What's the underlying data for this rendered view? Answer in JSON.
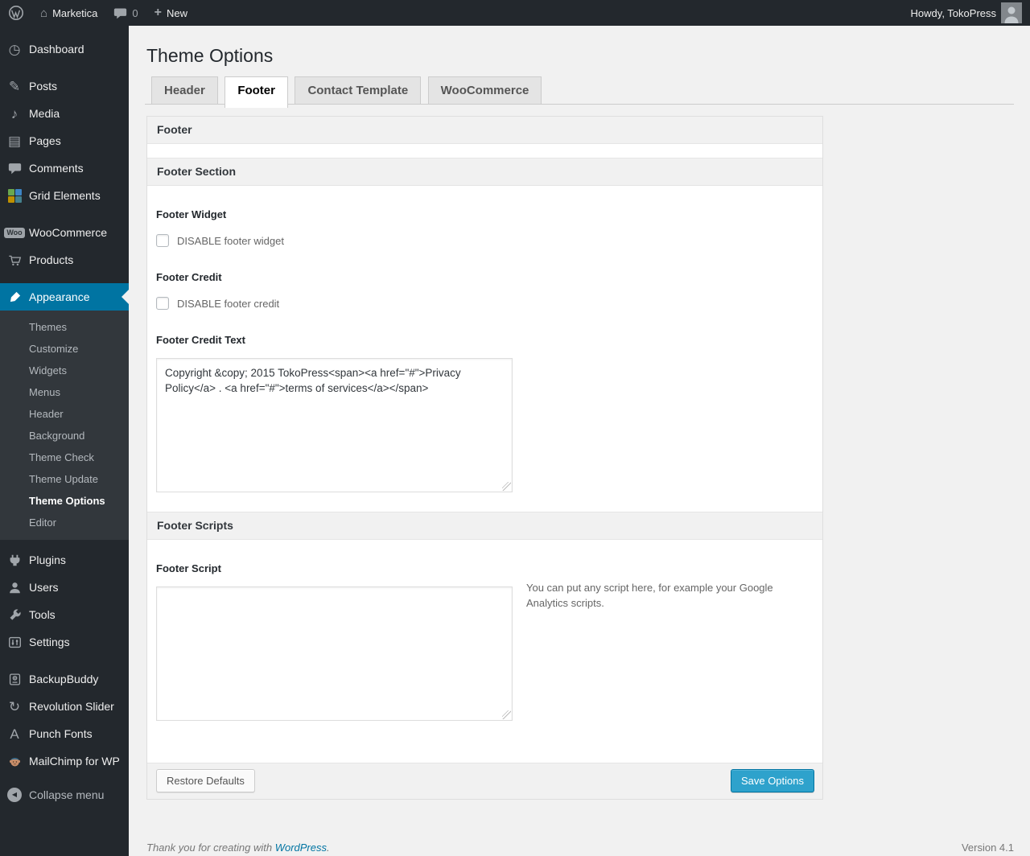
{
  "colors": {
    "accent_blue": "#0074a2",
    "button_blue": "#2ea2cc",
    "sidebar_bg": "#23282d",
    "submenu_bg": "#32373c",
    "page_bg": "#f1f1f1",
    "grid_icon_colors": [
      "#6aa84f",
      "#3d85c6",
      "#bf9000",
      "#45818e"
    ]
  },
  "admin_bar": {
    "wp_logo_icon": "wordpress-logo",
    "site_name": "Marketica",
    "comments_count": "0",
    "new_glyph": "+",
    "new_label": "New",
    "howdy": "Howdy, TokoPress",
    "home_glyph": "⌂"
  },
  "sidebar": {
    "items": [
      {
        "label": "Dashboard",
        "icon": "dashboard-icon",
        "glyph": "◷"
      },
      {
        "label": "Posts",
        "icon": "posts-icon",
        "glyph": "✎"
      },
      {
        "label": "Media",
        "icon": "media-icon",
        "glyph": "♪"
      },
      {
        "label": "Pages",
        "icon": "pages-icon",
        "glyph": "▤"
      },
      {
        "label": "Comments",
        "icon": "comments-icon"
      },
      {
        "label": "Grid Elements",
        "icon": "grid-elements-icon"
      },
      {
        "label": "WooCommerce",
        "icon": "woocommerce-icon",
        "badge": "Woo"
      },
      {
        "label": "Products",
        "icon": "cart-icon"
      },
      {
        "label": "Appearance",
        "icon": "appearance-icon",
        "active": true
      },
      {
        "label": "Plugins",
        "icon": "plugins-icon"
      },
      {
        "label": "Users",
        "icon": "users-icon"
      },
      {
        "label": "Tools",
        "icon": "tools-icon"
      },
      {
        "label": "Settings",
        "icon": "settings-icon"
      },
      {
        "label": "BackupBuddy",
        "icon": "backup-icon"
      },
      {
        "label": "Revolution Slider",
        "icon": "revolution-slider-icon",
        "glyph": "↻"
      },
      {
        "label": "Punch Fonts",
        "icon": "punch-fonts-icon",
        "glyph": "A"
      },
      {
        "label": "MailChimp for WP",
        "icon": "mailchimp-icon"
      },
      {
        "label": "Collapse menu",
        "icon": "collapse-icon",
        "glyph": "◀"
      }
    ],
    "appearance_submenu": [
      "Themes",
      "Customize",
      "Widgets",
      "Menus",
      "Header",
      "Background",
      "Theme Check",
      "Theme Update",
      "Theme Options",
      "Editor"
    ],
    "current_submenu_item": "Theme Options"
  },
  "page": {
    "title": "Theme Options",
    "tabs": [
      {
        "label": "Header"
      },
      {
        "label": "Footer",
        "active": true
      },
      {
        "label": "Contact Template"
      },
      {
        "label": "WooCommerce"
      }
    ]
  },
  "panel": {
    "title": "Footer",
    "section1": {
      "title": "Footer Section",
      "footer_widget_label": "Footer Widget",
      "footer_widget_checkbox_label": "DISABLE footer widget",
      "footer_widget_checked": false,
      "footer_credit_label": "Footer Credit",
      "footer_credit_checkbox_label": "DISABLE footer credit",
      "footer_credit_checked": false,
      "footer_credit_text_label": "Footer Credit Text",
      "footer_credit_text_value": "Copyright &copy; 2015 TokoPress<span><a href=\"#\">Privacy Policy</a> . <a href=\"#\">terms of services</a></span>"
    },
    "section2": {
      "title": "Footer Scripts",
      "footer_script_label": "Footer Script",
      "footer_script_value": "",
      "footer_script_help": "You can put any script here, for example your Google Analytics scripts."
    },
    "buttons": {
      "restore": "Restore Defaults",
      "save": "Save Options"
    }
  },
  "footer": {
    "thanks_prefix": "Thank you for creating with ",
    "thanks_link": "WordPress",
    "thanks_suffix": ".",
    "version": "Version 4.1"
  }
}
